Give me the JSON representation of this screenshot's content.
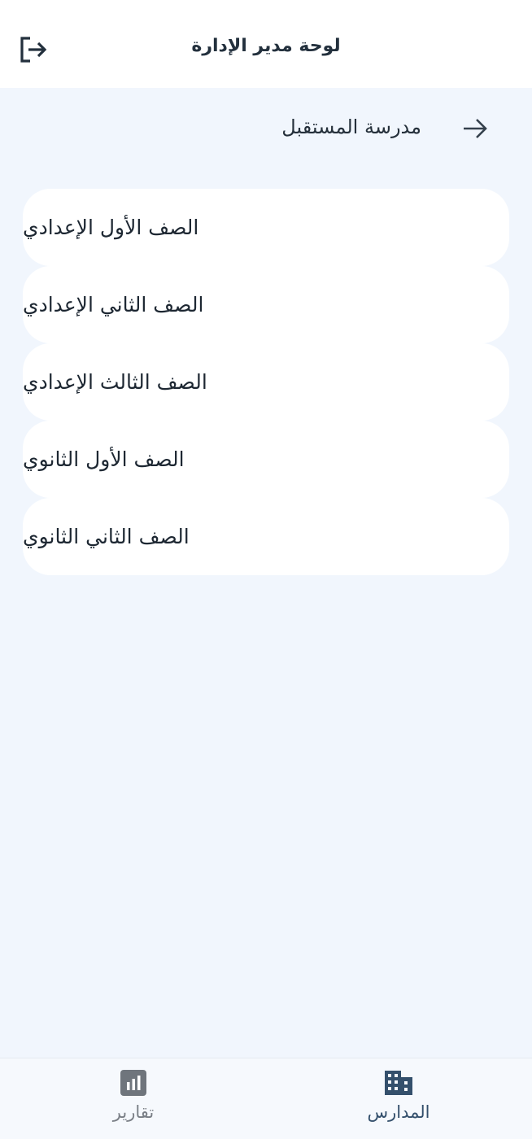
{
  "header": {
    "title": "لوحة مدير الإدارة",
    "logout_icon": "logout-icon"
  },
  "subheader": {
    "school_name": "مدرسة المستقبل",
    "back_icon": "arrow-right-icon"
  },
  "grades": [
    {
      "label": "الصف الأول الإعدادي"
    },
    {
      "label": "الصف الثاني الإعدادي"
    },
    {
      "label": "الصف الثالث الإعدادي"
    },
    {
      "label": "الصف الأول الثانوي"
    },
    {
      "label": "الصف الثاني الثانوي"
    }
  ],
  "bottom_nav": {
    "schools": {
      "label": "المدارس",
      "icon": "building-icon",
      "active": true
    },
    "reports": {
      "label": "تقارير",
      "icon": "bar-chart-icon",
      "active": false
    }
  },
  "colors": {
    "background": "#f1f6fd",
    "card": "#ffffff",
    "active_nav": "#34506c",
    "inactive_nav": "#7a7f86"
  }
}
